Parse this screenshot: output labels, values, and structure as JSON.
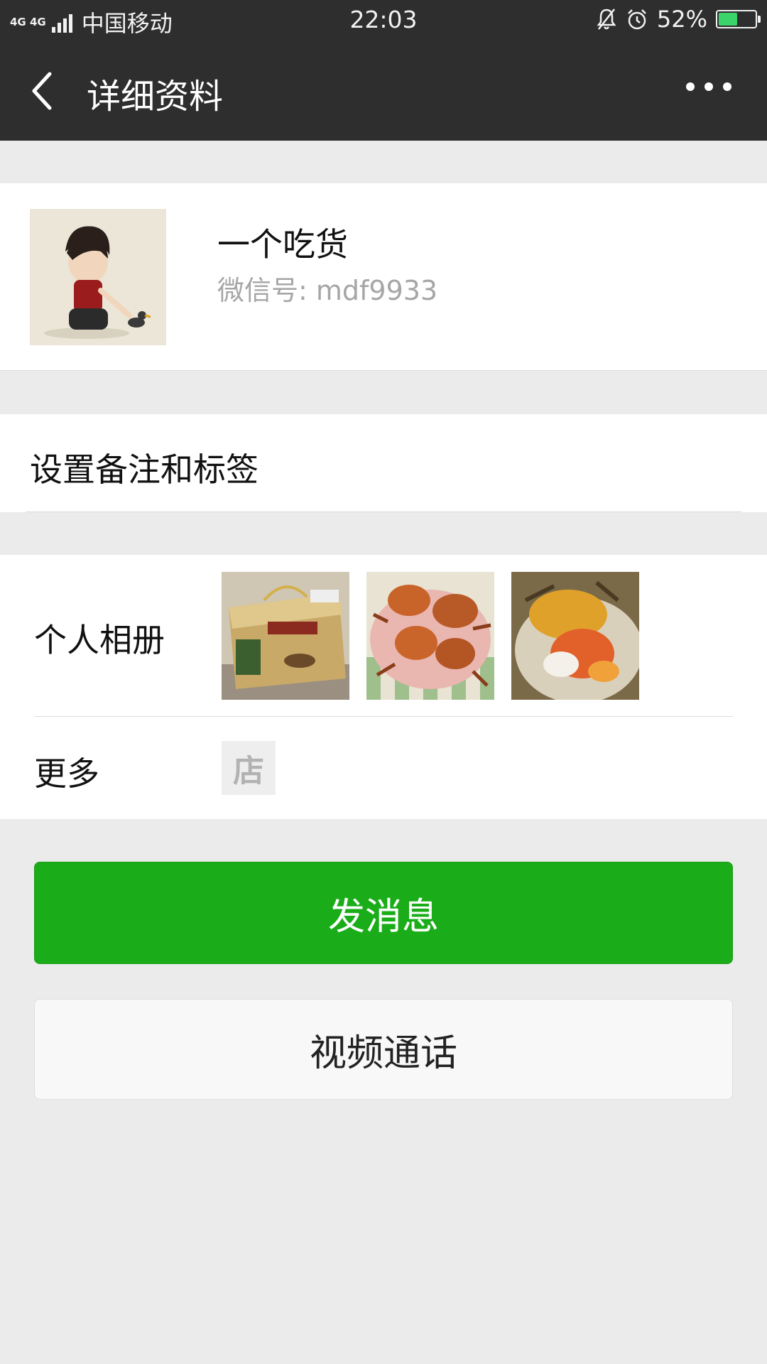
{
  "status_bar": {
    "network": "4G 4G",
    "carrier": "中国移动",
    "time": "22:03",
    "battery_percent": "52%",
    "battery_level": 0.52,
    "icons": [
      "signal-icon",
      "mute-bell-icon",
      "alarm-icon",
      "battery-charging-icon"
    ]
  },
  "nav": {
    "title": "详细资料"
  },
  "profile": {
    "name": "一个吃货",
    "wechat_id": "微信号: mdf9933"
  },
  "remark": {
    "label": "设置备注和标签"
  },
  "album": {
    "label": "个人相册",
    "photos": [
      "crab-gift-box-photo",
      "crabs-on-plate-photo",
      "cooked-crab-photo"
    ]
  },
  "more": {
    "label": "更多",
    "shop_icon_text": "店"
  },
  "buttons": {
    "send_message": "发消息",
    "video_call": "视频通话"
  },
  "colors": {
    "header_bg": "#2e2e2e",
    "primary_green": "#1aad19",
    "page_bg": "#ebebeb"
  }
}
